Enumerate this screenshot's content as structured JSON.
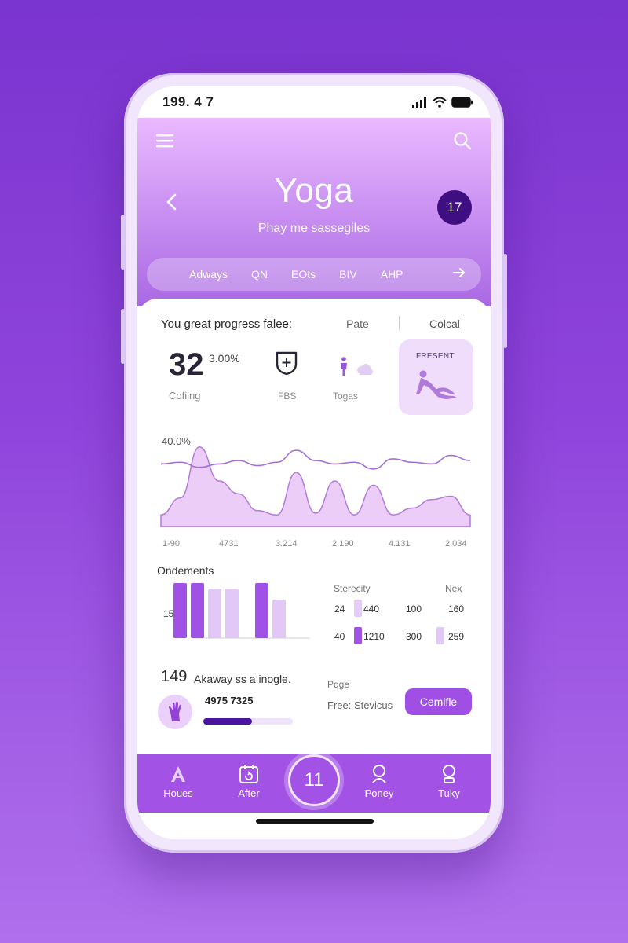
{
  "status_bar": {
    "time": "199. 4 7"
  },
  "header": {
    "title": "Yoga",
    "subtitle": "Phay me sassegiles",
    "badge": "17",
    "tabs": [
      "Adways",
      "QN",
      "EOts",
      "BIV",
      "AHP"
    ]
  },
  "progress": {
    "title": "You great progress falee:",
    "meta_a": "Pate",
    "meta_b": "Colcal",
    "stat_value": "32",
    "stat_percent": "3.00%",
    "stat_label": "Cofiing",
    "icon1_label": "FBS",
    "icon2_label": "Togas",
    "present_label": "FRESENT"
  },
  "chart_data": {
    "type": "area",
    "top_label": "40.0%",
    "x_ticks": [
      "1-90",
      "4731",
      "3.214",
      "2.190",
      "4.131",
      "2.034"
    ],
    "line_series": [
      0.7,
      0.72,
      0.66,
      0.7,
      0.74,
      0.68,
      0.72,
      0.86,
      0.74,
      0.7,
      0.72,
      0.64,
      0.76,
      0.72,
      0.7,
      0.8,
      0.74
    ],
    "area_series": [
      0.1,
      0.3,
      0.9,
      0.5,
      0.35,
      0.15,
      0.1,
      0.6,
      0.12,
      0.5,
      0.1,
      0.45,
      0.1,
      0.18,
      0.28,
      0.32,
      0.1
    ]
  },
  "orders": {
    "title": "Ondements",
    "axis_label": "15 $",
    "bars": [
      {
        "value": 1.0,
        "color": "#a052e6"
      },
      {
        "value": 1.0,
        "color": "#a052e6"
      },
      {
        "value": 0.9,
        "color": "#e2c8f7"
      },
      {
        "value": 0.9,
        "color": "#e2c8f7"
      },
      {
        "value": 1.0,
        "color": "#a052e6"
      },
      {
        "value": 0.7,
        "color": "#e2c8f7"
      }
    ],
    "table": {
      "head_a": "Sterecity",
      "head_b": "Nex",
      "rows": [
        {
          "a": "24",
          "b": "440",
          "c": "100",
          "d": "160"
        },
        {
          "a": "40",
          "b": "1210",
          "c": "300",
          "d": "259"
        }
      ]
    }
  },
  "activity": {
    "big_number": "149",
    "text": "Akaway ss a inogle.",
    "sub_number": "4975 7325",
    "progress": 0.54,
    "page_label": "Pqge",
    "free_label": "Free: Stevicus",
    "cta": "Cemifle"
  },
  "nav": {
    "items": [
      {
        "label": "Houes"
      },
      {
        "label": "After"
      },
      {
        "label": "Poney"
      },
      {
        "label": "Tuky"
      }
    ],
    "center": "11"
  },
  "colors": {
    "accent": "#a253e6",
    "dark_badge": "#3f0f82",
    "progress_fill": "#4b14a1"
  }
}
